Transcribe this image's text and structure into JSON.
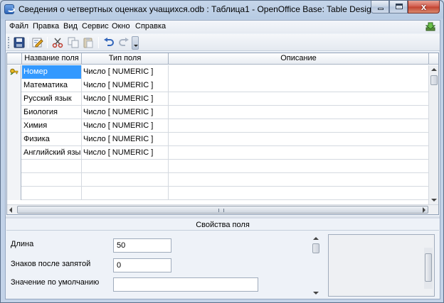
{
  "window": {
    "title": "Сведения о четвертных оценках учащихся.odb : Таблица1 - OpenOffice Base: Table Design",
    "close_glyph": "x"
  },
  "menu": {
    "items": [
      {
        "label": "Файл"
      },
      {
        "label": "Правка"
      },
      {
        "label": "Вид"
      },
      {
        "label": "Сервис"
      },
      {
        "label": "Окно"
      },
      {
        "label": "Справка"
      }
    ]
  },
  "toolbar": {
    "icons": [
      "save-icon",
      "edit-icon",
      "cut-icon",
      "copy-icon",
      "paste-icon",
      "undo-icon",
      "redo-icon"
    ]
  },
  "table": {
    "columns": [
      "Название поля",
      "Тип поля",
      "Описание"
    ],
    "rows": [
      {
        "name": "Номер",
        "type": "Число [ NUMERIC ]",
        "description": ""
      },
      {
        "name": "Математика",
        "type": "Число [ NUMERIC ]",
        "description": ""
      },
      {
        "name": "Русский язык",
        "type": "Число [ NUMERIC ]",
        "description": ""
      },
      {
        "name": "Биология",
        "type": "Число [ NUMERIC ]",
        "description": ""
      },
      {
        "name": "Химия",
        "type": "Число [ NUMERIC ]",
        "description": ""
      },
      {
        "name": "Физика",
        "type": "Число [ NUMERIC ]",
        "description": ""
      },
      {
        "name": "Английский язык",
        "type": "Число [ NUMERIC ]",
        "description": ""
      }
    ],
    "selected_row": 0,
    "primary_key_icon": "key-icon"
  },
  "properties": {
    "title": "Свойства поля",
    "length_label": "Длина",
    "length_value": "50",
    "decimals_label": "Знаков после запятой",
    "decimals_value": "0",
    "default_label": "Значение по умолчанию",
    "default_value": ""
  },
  "colors": {
    "selection": "#3399ff",
    "window_frame": "#c9d7e8"
  }
}
